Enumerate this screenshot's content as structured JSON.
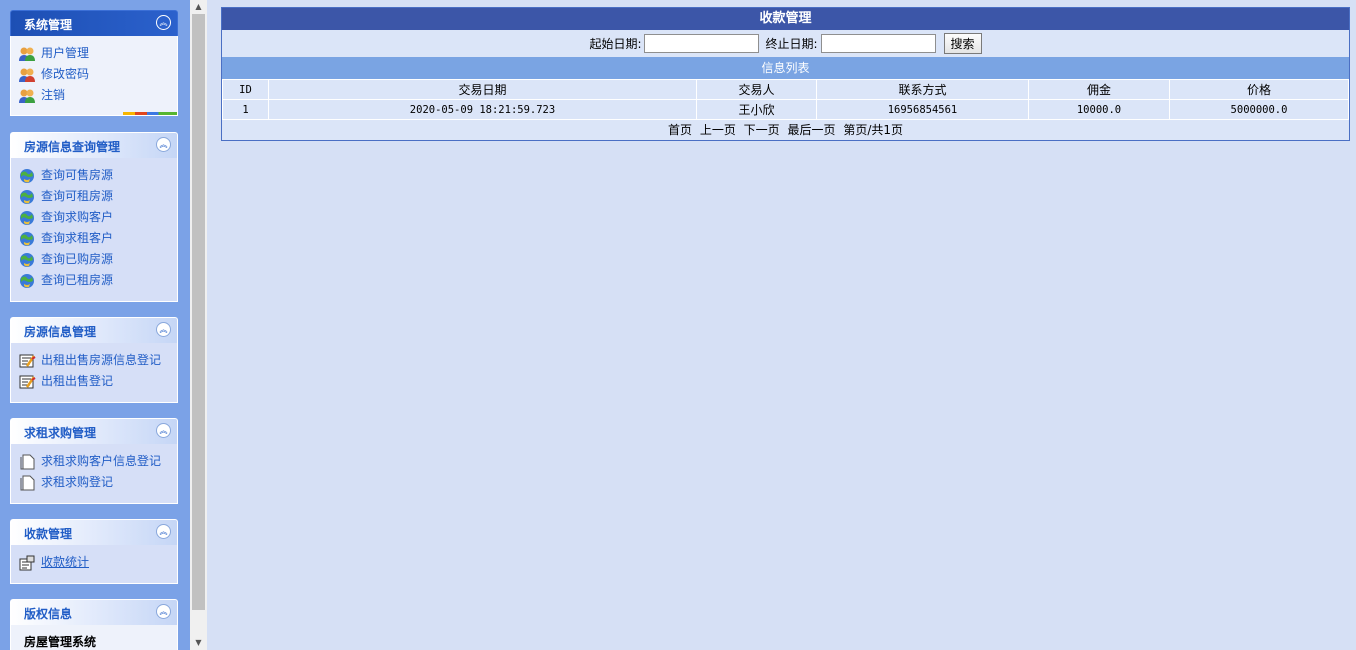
{
  "sidebar": {
    "panels": [
      {
        "title": "系统管理",
        "items": [
          {
            "label": "用户管理",
            "icon": "users-icon"
          },
          {
            "label": "修改密码",
            "icon": "users-icon"
          },
          {
            "label": "注销",
            "icon": "users-icon"
          }
        ]
      },
      {
        "title": "房源信息查询管理",
        "items": [
          {
            "label": "查询可售房源",
            "icon": "globe-icon"
          },
          {
            "label": "查询可租房源",
            "icon": "globe-icon"
          },
          {
            "label": "查询求购客户",
            "icon": "globe-icon"
          },
          {
            "label": "查询求租客户",
            "icon": "globe-icon"
          },
          {
            "label": "查询已购房源",
            "icon": "globe-icon"
          },
          {
            "label": "查询已租房源",
            "icon": "globe-icon"
          }
        ]
      },
      {
        "title": "房源信息管理",
        "items": [
          {
            "label": "出租出售房源信息登记",
            "icon": "edit-document-icon"
          },
          {
            "label": "出租出售登记",
            "icon": "edit-document-icon"
          }
        ]
      },
      {
        "title": "求租求购管理",
        "items": [
          {
            "label": "求租求购客户信息登记",
            "icon": "document-icon"
          },
          {
            "label": "求租求购登记",
            "icon": "document-icon"
          }
        ]
      },
      {
        "title": "收款管理",
        "items": [
          {
            "label": "收款统计",
            "icon": "calculator-icon"
          }
        ]
      },
      {
        "title": "版权信息",
        "text": "房屋管理系统"
      }
    ]
  },
  "main": {
    "title": "收款管理",
    "search": {
      "start_label": "起始日期:",
      "end_label": "终止日期:",
      "start_value": "",
      "end_value": "",
      "button_label": "搜索"
    },
    "list_title": "信息列表",
    "table": {
      "columns": [
        "ID",
        "交易日期",
        "交易人",
        "联系方式",
        "佣金",
        "价格"
      ],
      "rows": [
        [
          "1",
          "2020-05-09 18:21:59.723",
          "王小欣",
          "16956854561",
          "10000.0",
          "5000000.0"
        ]
      ]
    },
    "pager": {
      "first": "首页",
      "prev": "上一页",
      "next": "下一页",
      "last": "最后一页",
      "info": "第页/共1页"
    }
  },
  "colors": {
    "sidebar_bg": "#7ba2e7",
    "content_bg": "#d6e0f5",
    "header_bar": "#3c56a8",
    "subheader_bar": "#7aa4e3",
    "link": "#215dc6"
  }
}
